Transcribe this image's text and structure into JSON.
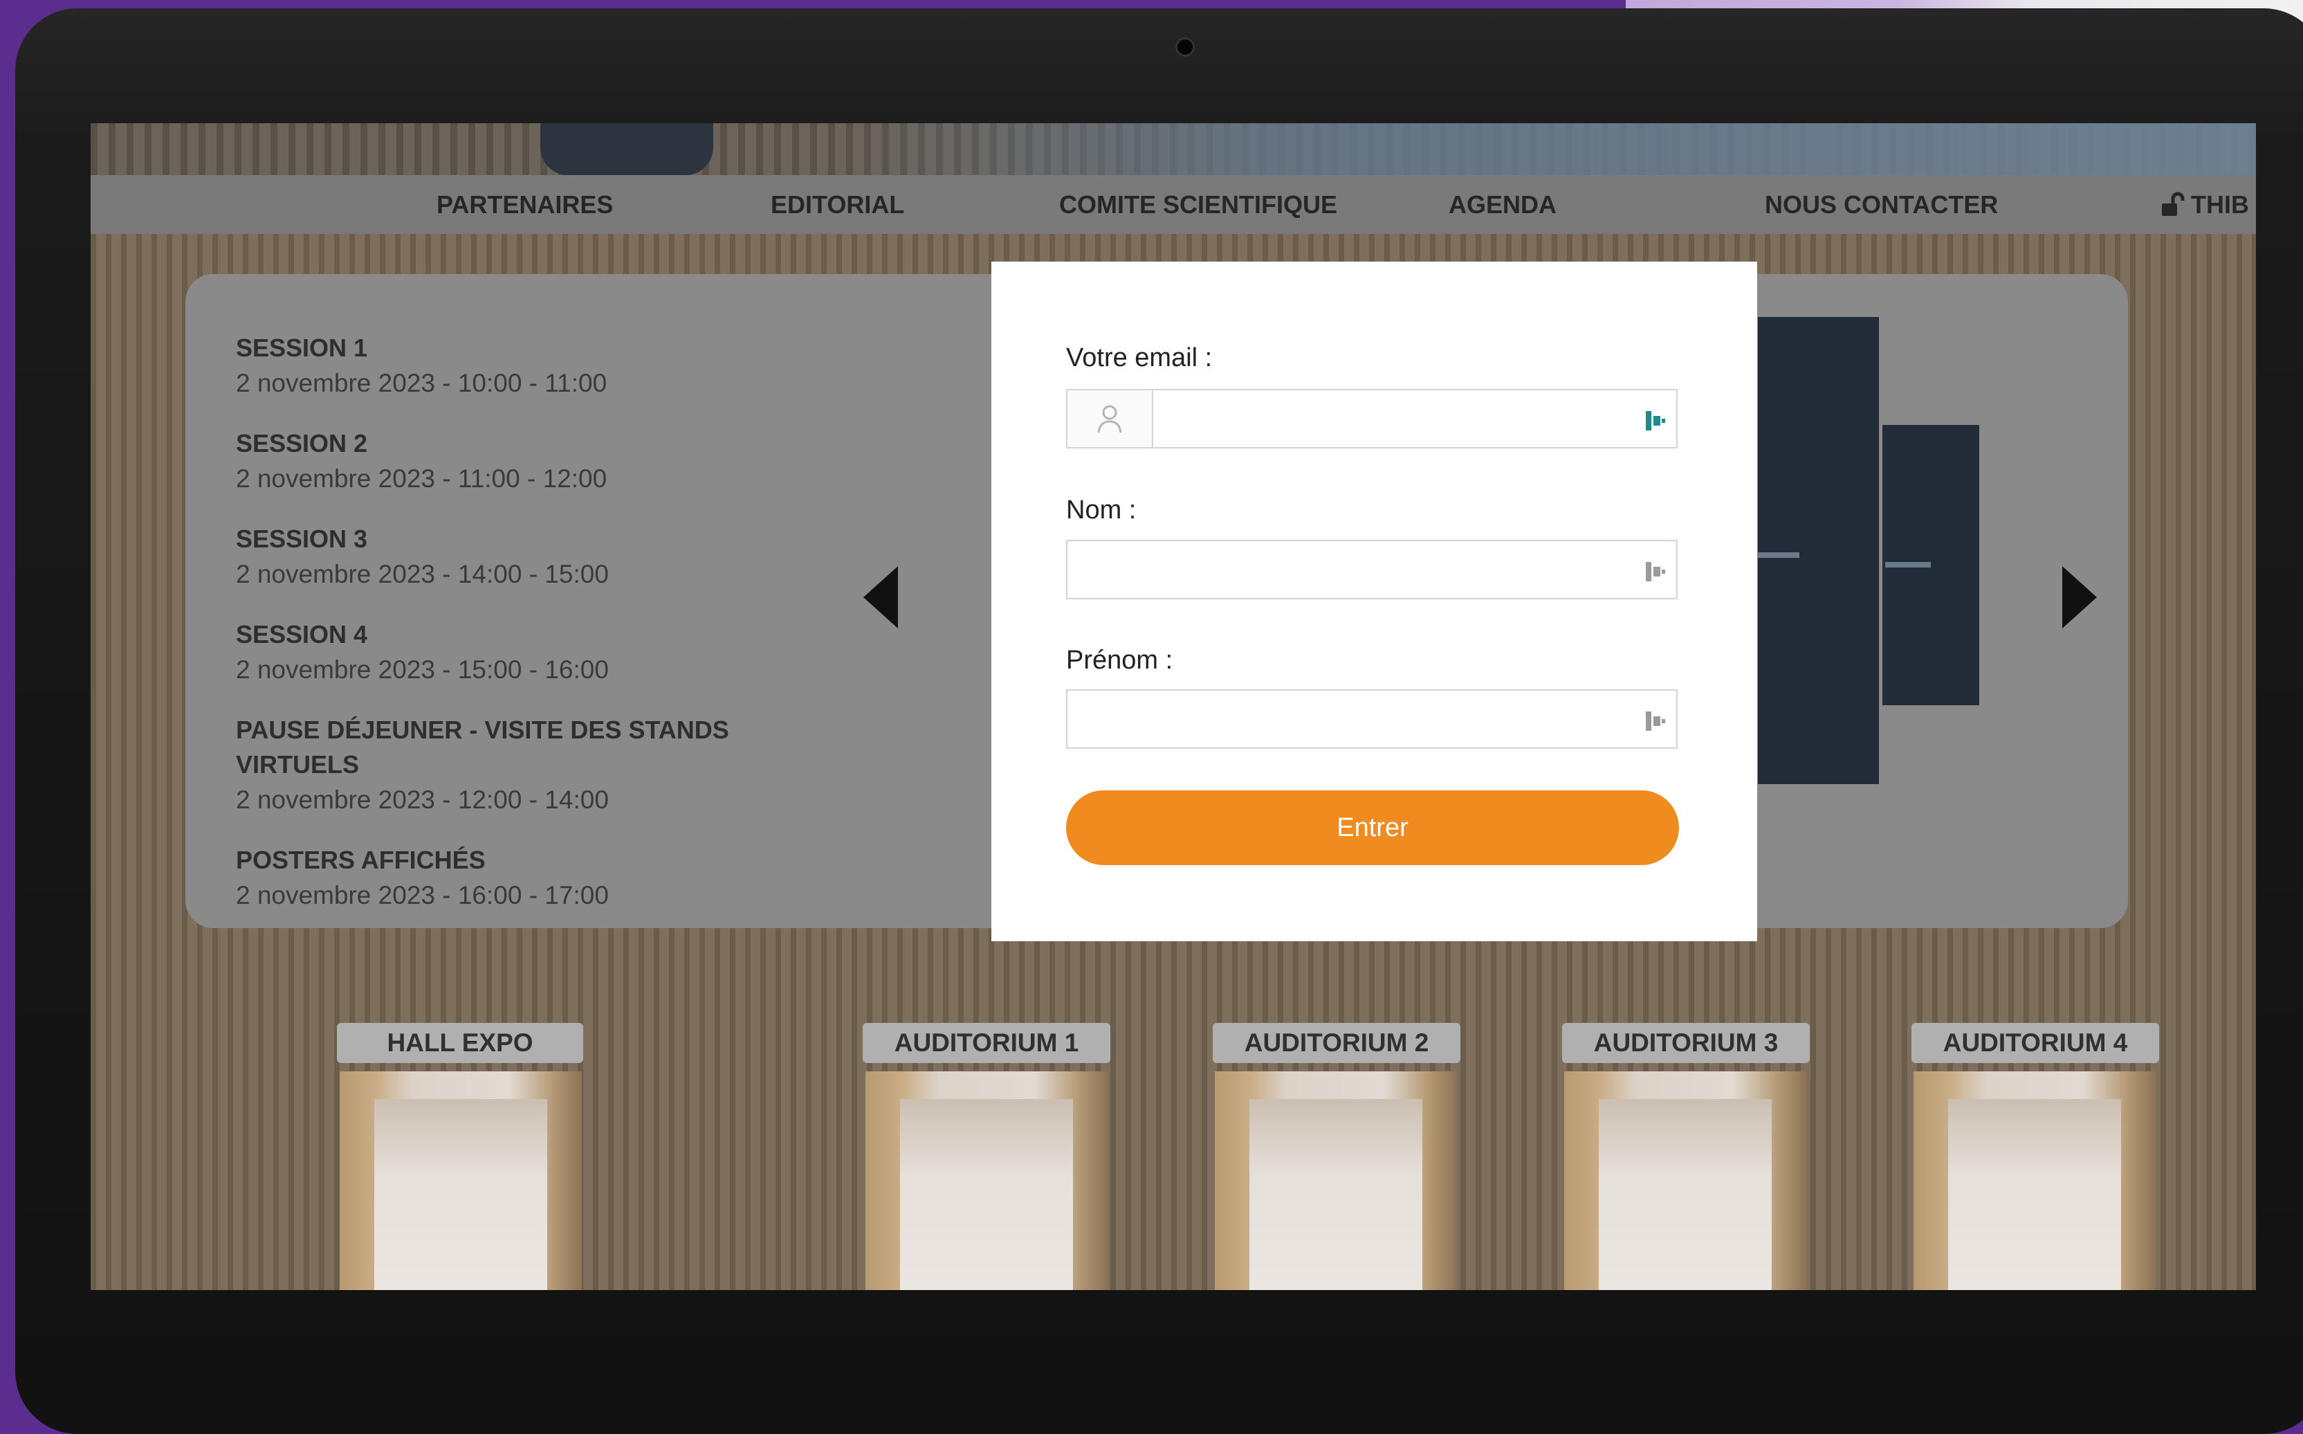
{
  "nav": {
    "items": [
      {
        "label": "PARTENAIRES"
      },
      {
        "label": "EDITORIAL"
      },
      {
        "label": "COMITE SCIENTIFIQUE"
      },
      {
        "label": "AGENDA"
      },
      {
        "label": "NOUS CONTACTER"
      }
    ],
    "user_label": "THIB"
  },
  "agenda": {
    "sessions": [
      {
        "title": "SESSION 1",
        "time": "2 novembre 2023 - 10:00 - 11:00"
      },
      {
        "title": "SESSION 2",
        "time": "2 novembre 2023 - 11:00 - 12:00"
      },
      {
        "title": "SESSION 3",
        "time": "2 novembre 2023 - 14:00 - 15:00"
      },
      {
        "title": "SESSION 4",
        "time": "2 novembre 2023 - 15:00 - 16:00"
      },
      {
        "title": "PAUSE DÉJEUNER - VISITE DES STANDS VIRTUELS",
        "time": "2 novembre 2023 - 12:00 - 14:00"
      },
      {
        "title": "POSTERS AFFICHÉS",
        "time": "2 novembre 2023 - 16:00 - 17:00"
      }
    ]
  },
  "rooms": [
    {
      "label": "HALL EXPO"
    },
    {
      "label": "AUDITORIUM 1"
    },
    {
      "label": "AUDITORIUM 2"
    },
    {
      "label": "AUDITORIUM 3"
    },
    {
      "label": "AUDITORIUM 4"
    }
  ],
  "login": {
    "email_label": "Votre email :",
    "email_value": "",
    "nom_label": "Nom :",
    "nom_value": "",
    "prenom_label": "Prénom :",
    "prenom_value": "",
    "submit_label": "Entrer"
  },
  "colors": {
    "accent": "#f08c1f",
    "background": "#5b2d8e"
  },
  "icons": {
    "lock": "unlock-icon",
    "user": "user-icon",
    "autofill": "autofill-icon",
    "prev": "arrow-left-icon",
    "next": "arrow-right-icon"
  }
}
